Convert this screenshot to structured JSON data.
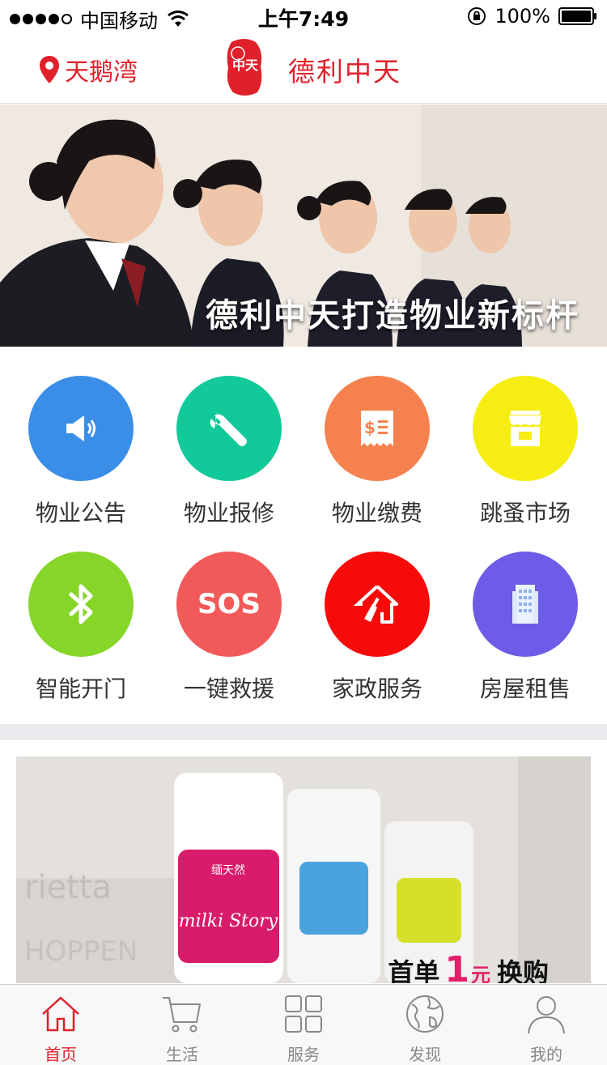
{
  "status_bar": {
    "carrier": "中国移动",
    "time": "上午7:49",
    "battery": "100%"
  },
  "header": {
    "location": "天鹅湾",
    "logo_text": "中天",
    "brand": "德利中天",
    "accent": "#e0202a"
  },
  "banner": {
    "caption": "德利中天打造物业新标杆",
    "slides": 5,
    "active_slide": 1
  },
  "services": [
    {
      "label": "物业公告",
      "icon": "megaphone-icon",
      "color": "#3a8ee8"
    },
    {
      "label": "物业报修",
      "icon": "wrench-icon",
      "color": "#12c99a"
    },
    {
      "label": "物业缴费",
      "icon": "bill-icon",
      "color": "#f5824e"
    },
    {
      "label": "跳蚤市场",
      "icon": "shop-icon",
      "color": "#f6ee12"
    },
    {
      "label": "智能开门",
      "icon": "bluetooth-icon",
      "color": "#86d62a"
    },
    {
      "label": "一键救援",
      "icon": "sos-icon",
      "icon_text": "SOS",
      "color": "#f25a5a"
    },
    {
      "label": "家政服务",
      "icon": "house-broom-icon",
      "color": "#f70a0a"
    },
    {
      "label": "房屋租售",
      "icon": "building-icon",
      "color": "#6c5ce7"
    }
  ],
  "ad": {
    "brand": "缅天然",
    "product": "milki Story",
    "bg_text_1": "rietta",
    "bg_text_2": "HOPPEN",
    "text_prefix": "首单",
    "number": "1",
    "unit": "元",
    "text_suffix": "换购"
  },
  "tabbar": [
    {
      "label": "首页",
      "icon": "home-icon",
      "active": true
    },
    {
      "label": "生活",
      "icon": "cart-icon",
      "active": false
    },
    {
      "label": "服务",
      "icon": "grid-icon",
      "active": false
    },
    {
      "label": "发现",
      "icon": "globe-icon",
      "active": false
    },
    {
      "label": "我的",
      "icon": "user-icon",
      "active": false
    }
  ]
}
